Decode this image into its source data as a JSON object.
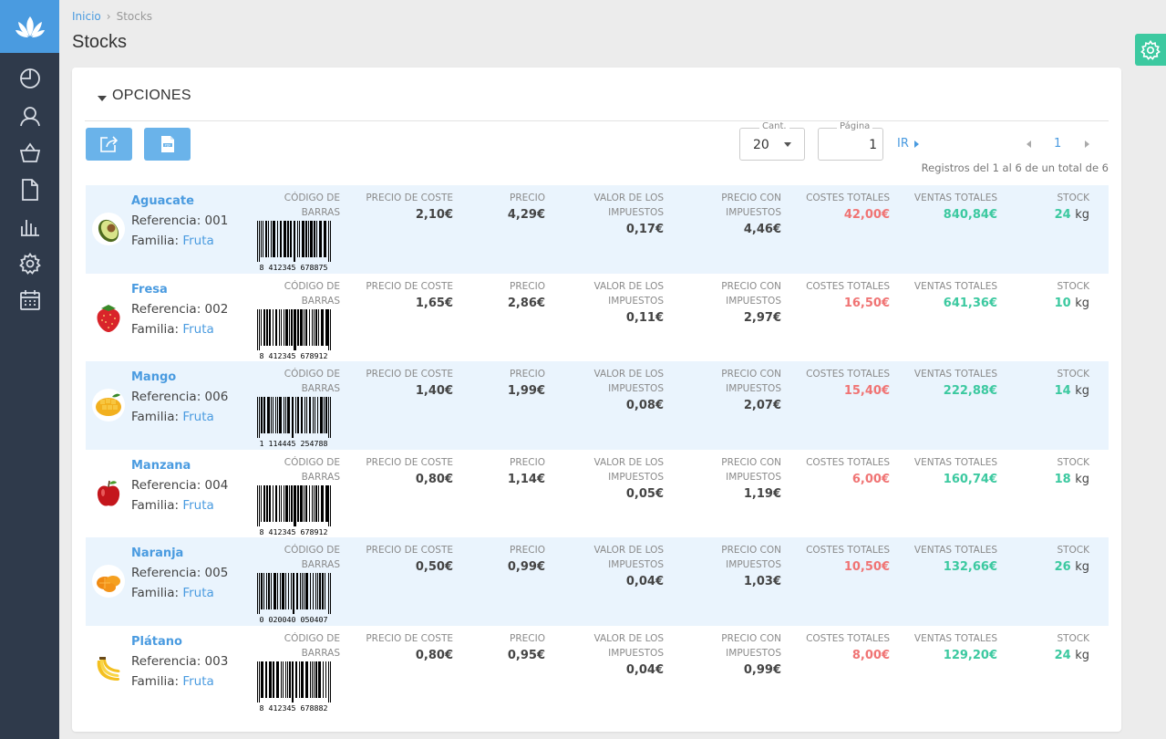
{
  "breadcrumb": {
    "home": "Inicio",
    "separator": "›",
    "current": "Stocks"
  },
  "page_title": "Stocks",
  "options": {
    "title": "OPCIONES",
    "qty_label": "Cant.",
    "qty_value": "20",
    "page_label": "Página",
    "page_value": "1",
    "go_label": "IR",
    "current_page": "1",
    "records_info": "Registros del 1 al 6 de un total de 6"
  },
  "columns": {
    "barcode": "Código de barras",
    "cost_price": "Precio de coste",
    "price": "Precio",
    "tax_value": "Valor de los impuestos",
    "price_with_tax": "Precio con impuestos",
    "total_costs": "Costes totales",
    "total_sales": "Ventas totales",
    "stock": "Stock"
  },
  "colors": {
    "accent": "#4a9be0",
    "sidebar": "#2f3a4b",
    "green": "#3cc9a0",
    "red": "#f07474",
    "row_alt": "#eaf4fd"
  },
  "products": [
    {
      "name": "Aguacate",
      "ref": "Referencia: 001",
      "family_label": "Familia:",
      "family": "Fruta",
      "barcode": "8 412345 678875",
      "cost": "2,10€",
      "price": "4,29€",
      "tax": "0,17€",
      "price_tax": "4,46€",
      "total_cost": "42,00€",
      "total_sales": "840,84€",
      "stock": "24",
      "unit": "kg",
      "icon": "avocado-icon"
    },
    {
      "name": "Fresa",
      "ref": "Referencia: 002",
      "family_label": "Familia:",
      "family": "Fruta",
      "barcode": "8 412345 678912",
      "cost": "1,65€",
      "price": "2,86€",
      "tax": "0,11€",
      "price_tax": "2,97€",
      "total_cost": "16,50€",
      "total_sales": "641,36€",
      "stock": "10",
      "unit": "kg",
      "icon": "strawberry-icon"
    },
    {
      "name": "Mango",
      "ref": "Referencia: 006",
      "family_label": "Familia:",
      "family": "Fruta",
      "barcode": "1 114445 254788",
      "cost": "1,40€",
      "price": "1,99€",
      "tax": "0,08€",
      "price_tax": "2,07€",
      "total_cost": "15,40€",
      "total_sales": "222,88€",
      "stock": "14",
      "unit": "kg",
      "icon": "mango-icon"
    },
    {
      "name": "Manzana",
      "ref": "Referencia: 004",
      "family_label": "Familia:",
      "family": "Fruta",
      "barcode": "8 412345 678912",
      "cost": "0,80€",
      "price": "1,14€",
      "tax": "0,05€",
      "price_tax": "1,19€",
      "total_cost": "6,00€",
      "total_sales": "160,74€",
      "stock": "18",
      "unit": "kg",
      "icon": "apple-icon"
    },
    {
      "name": "Naranja",
      "ref": "Referencia: 005",
      "family_label": "Familia:",
      "family": "Fruta",
      "barcode": "0 020040 050407",
      "cost": "0,50€",
      "price": "0,99€",
      "tax": "0,04€",
      "price_tax": "1,03€",
      "total_cost": "10,50€",
      "total_sales": "132,66€",
      "stock": "26",
      "unit": "kg",
      "icon": "orange-icon"
    },
    {
      "name": "Plátano",
      "ref": "Referencia: 003",
      "family_label": "Familia:",
      "family": "Fruta",
      "barcode": "8 412345 678882",
      "cost": "0,80€",
      "price": "0,95€",
      "tax": "0,04€",
      "price_tax": "0,99€",
      "total_cost": "8,00€",
      "total_sales": "129,20€",
      "stock": "24",
      "unit": "kg",
      "icon": "banana-icon"
    }
  ]
}
